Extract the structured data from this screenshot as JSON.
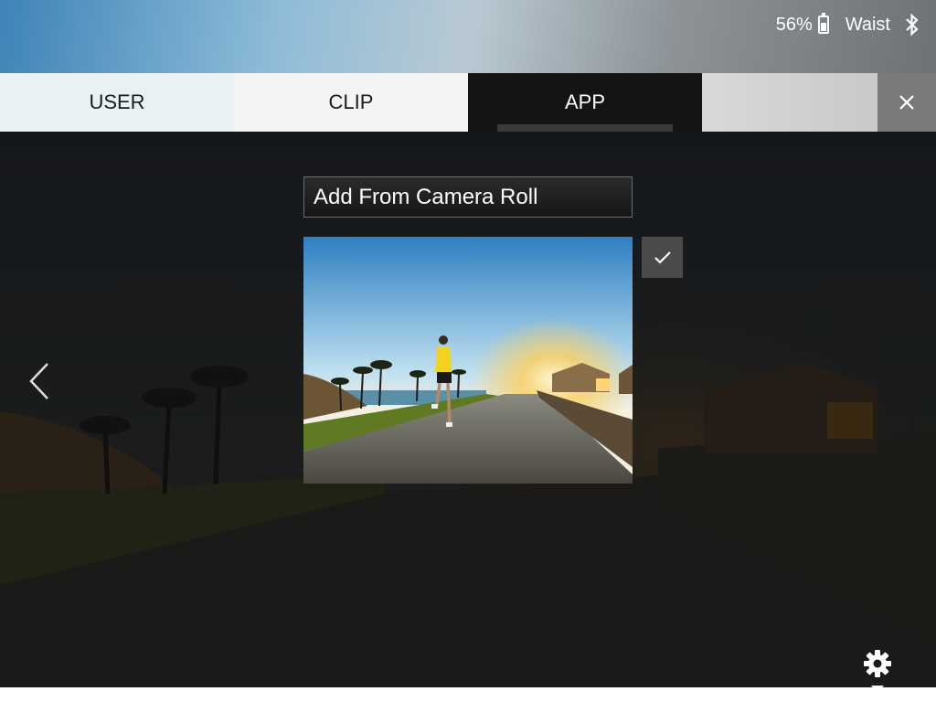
{
  "status": {
    "battery_percent": "56%",
    "battery_level": 0.56,
    "location": "Waist"
  },
  "tabs": [
    {
      "label": "USER",
      "active": false
    },
    {
      "label": "CLIP",
      "active": false
    },
    {
      "label": "APP",
      "active": true
    }
  ],
  "main": {
    "add_button_label": "Add From Camera Roll",
    "photo_selected": true
  },
  "icons": {
    "battery": "battery-icon",
    "bluetooth": "bluetooth-icon",
    "close": "close-icon",
    "check": "check-icon",
    "prev": "chevron-left-icon",
    "settings": "gear-icon"
  },
  "colors": {
    "active_tab": "#141414",
    "close_bg": "#7b7b7b",
    "check_bg": "#4a4a4a"
  }
}
